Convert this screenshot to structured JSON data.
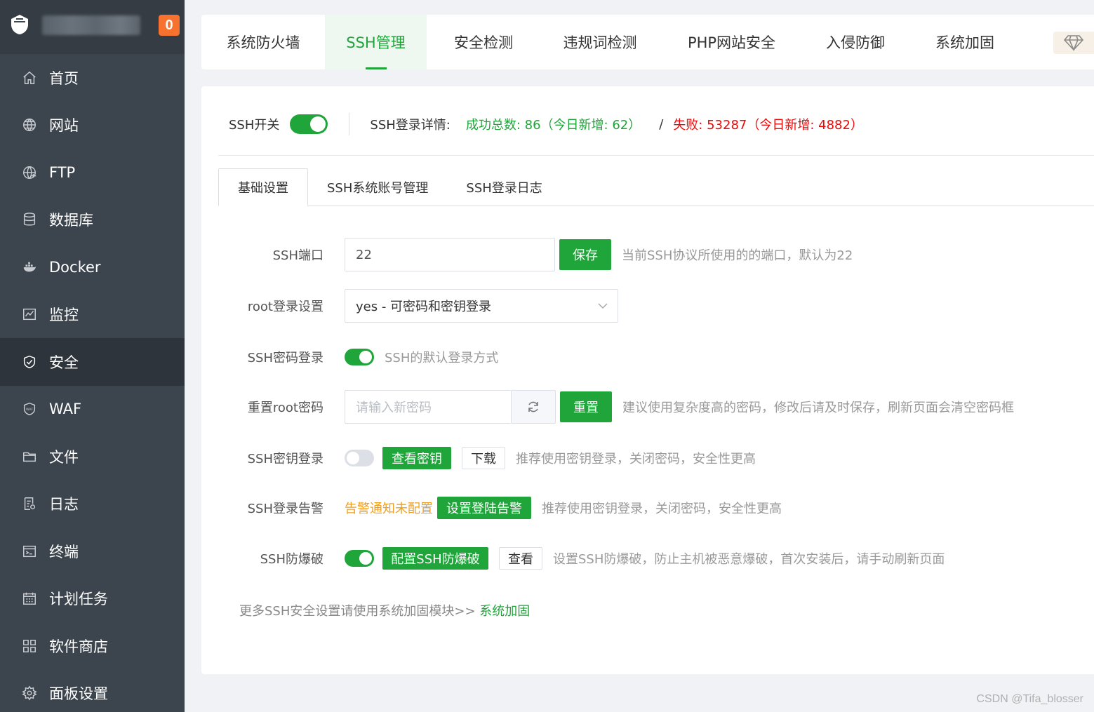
{
  "sidebar": {
    "notice_count": "0",
    "items": [
      {
        "label": "首页",
        "icon": "home-icon"
      },
      {
        "label": "网站",
        "icon": "globe-icon"
      },
      {
        "label": "FTP",
        "icon": "ftp-icon"
      },
      {
        "label": "数据库",
        "icon": "database-icon"
      },
      {
        "label": "Docker",
        "icon": "docker-icon"
      },
      {
        "label": "监控",
        "icon": "monitor-icon"
      },
      {
        "label": "安全",
        "icon": "shield-icon"
      },
      {
        "label": "WAF",
        "icon": "waf-icon"
      },
      {
        "label": "文件",
        "icon": "folder-icon"
      },
      {
        "label": "日志",
        "icon": "log-icon"
      },
      {
        "label": "终端",
        "icon": "terminal-icon"
      },
      {
        "label": "计划任务",
        "icon": "calendar-icon"
      },
      {
        "label": "软件商店",
        "icon": "apps-icon"
      },
      {
        "label": "面板设置",
        "icon": "gear-icon"
      }
    ],
    "active_index": 6
  },
  "top_tabs": {
    "items": [
      "系统防火墙",
      "SSH管理",
      "安全检测",
      "违规词检测",
      "PHP网站安全",
      "入侵防御",
      "系统加固"
    ],
    "active_index": 1
  },
  "ssh_status": {
    "switch_label": "SSH开关",
    "switch_on": true,
    "detail_label": "SSH登录详情:",
    "success_text": "成功总数: 86（今日新增: 62）",
    "slash": "/",
    "fail_text": "失败: 53287（今日新增: 4882）"
  },
  "sub_tabs": {
    "items": [
      "基础设置",
      "SSH系统账号管理",
      "SSH登录日志"
    ],
    "active_index": 0
  },
  "form": {
    "port": {
      "label": "SSH端口",
      "value": "22",
      "button": "保存",
      "hint": "当前SSH协议所使用的的端口，默认为22"
    },
    "root_login": {
      "label": "root登录设置",
      "selected": "yes - 可密码和密钥登录"
    },
    "password_login": {
      "label": "SSH密码登录",
      "on": true,
      "hint": "SSH的默认登录方式"
    },
    "reset_root": {
      "label": "重置root密码",
      "placeholder": "请输入新密码",
      "button": "重置",
      "hint": "建议使用复杂度高的密码，修改后请及时保存，刷新页面会清空密码框"
    },
    "key_login": {
      "label": "SSH密钥登录",
      "on": false,
      "view_button": "查看密钥",
      "download_button": "下载",
      "hint": "推荐使用密钥登录，关闭密码，安全性更高"
    },
    "login_alert": {
      "label": "SSH登录告警",
      "status": "告警通知未配置",
      "button": "设置登陆告警",
      "hint": "推荐使用密钥登录，关闭密码，安全性更高"
    },
    "brute_force": {
      "label": "SSH防爆破",
      "on": true,
      "config_button": "配置SSH防爆破",
      "view_button": "查看",
      "hint": "设置SSH防爆破，防止主机被恶意爆破，首次安装后，请手动刷新页面"
    }
  },
  "footer": {
    "note": "更多SSH安全设置请使用系统加固模块>> ",
    "link": "系统加固"
  },
  "watermark": "CSDN @Tifa_blosser",
  "colors": {
    "accent": "#20a53a",
    "sidebar": "#3c444d",
    "danger": "#ef0808",
    "warning": "#f0a020"
  }
}
